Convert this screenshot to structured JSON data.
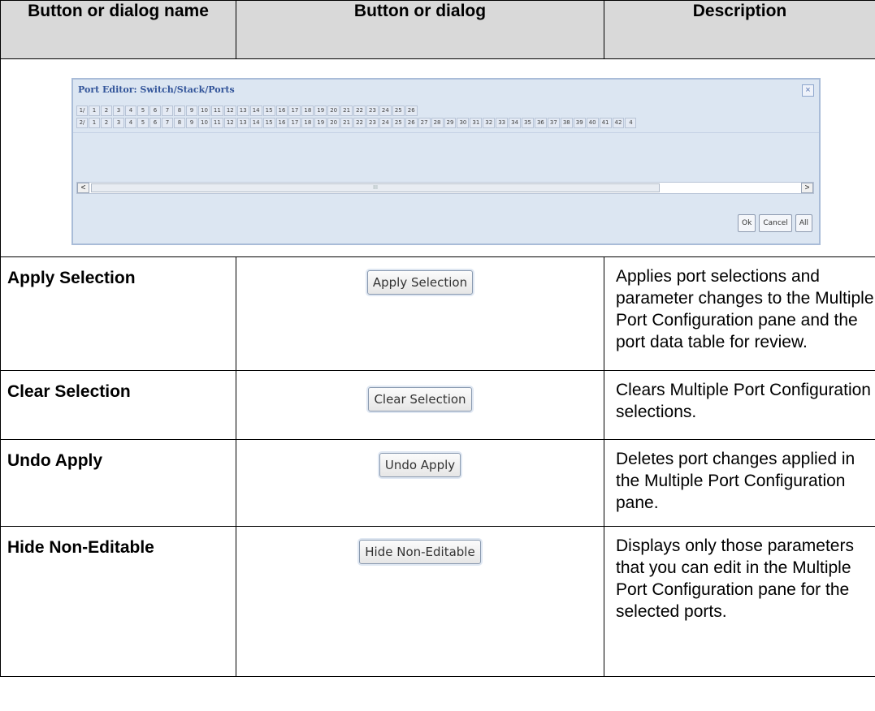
{
  "headers": [
    "Button or dialog name",
    "Button or dialog",
    "Description"
  ],
  "dialog": {
    "title": "Port Editor: Switch/Stack/Ports",
    "close_glyph": "×",
    "row1_prefix": "1/",
    "row2_prefix": "2/",
    "row1_ports": [
      "1",
      "2",
      "3",
      "4",
      "5",
      "6",
      "7",
      "8",
      "9",
      "10",
      "11",
      "12",
      "13",
      "14",
      "15",
      "16",
      "17",
      "18",
      "19",
      "20",
      "21",
      "22",
      "23",
      "24",
      "25",
      "26"
    ],
    "row2_ports": [
      "1",
      "2",
      "3",
      "4",
      "5",
      "6",
      "7",
      "8",
      "9",
      "10",
      "11",
      "12",
      "13",
      "14",
      "15",
      "16",
      "17",
      "18",
      "19",
      "20",
      "21",
      "22",
      "23",
      "24",
      "25",
      "26",
      "27",
      "28",
      "29",
      "30",
      "31",
      "32",
      "33",
      "34",
      "35",
      "36",
      "37",
      "38",
      "39",
      "40",
      "41",
      "42",
      "4"
    ],
    "scroll_left": "<",
    "scroll_right": ">",
    "scroll_grip": "III",
    "ok_label": "Ok",
    "cancel_label": "Cancel",
    "all_label": "All"
  },
  "rows": [
    {
      "name": "Apply Selection",
      "button_label": "Apply Selection",
      "description": "Applies port selections and parameter changes to the Multiple Port Configuration pane and the port data table for review."
    },
    {
      "name": "Clear Selection",
      "button_label": "Clear Selection",
      "description": "Clears Multiple Port Configuration selections."
    },
    {
      "name": "Undo Apply",
      "button_label": "Undo Apply",
      "description": "Deletes port changes applied in the Multiple Port Configuration pane."
    },
    {
      "name": "Hide Non-Editable",
      "button_label": "Hide Non-Editable",
      "description": "Displays only those parameters that you can edit in the Multiple Port Configuration pane for the selected ports."
    }
  ]
}
